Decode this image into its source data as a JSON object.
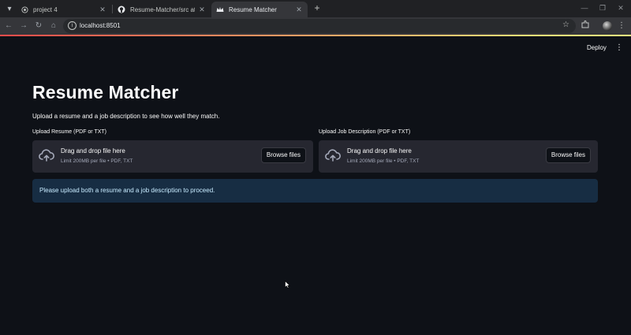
{
  "browser": {
    "tabs": [
      {
        "title": "project 4",
        "active": false
      },
      {
        "title": "Resume-Matcher/src at main · /",
        "active": false
      },
      {
        "title": "Resume Matcher",
        "active": true
      }
    ],
    "new_tab_symbol": "+",
    "url": "localhost:8501"
  },
  "app": {
    "deploy_label": "Deploy",
    "title": "Resume Matcher",
    "subtitle": "Upload a resume and a job description to see how well they match.",
    "uploaders": [
      {
        "label": "Upload Resume (PDF or TXT)",
        "drop_title": "Drag and drop file here",
        "limit_text": "Limit 200MB per file • PDF, TXT",
        "button_label": "Browse files"
      },
      {
        "label": "Upload Job Description (PDF or TXT)",
        "drop_title": "Drag and drop file here",
        "limit_text": "Limit 200MB per file • PDF, TXT",
        "button_label": "Browse files"
      }
    ],
    "info_message": "Please upload both a resume and a job description to proceed."
  },
  "colors": {
    "background": "#0e1117",
    "dropzone": "#262730",
    "info_bg": "#172d43",
    "info_text": "#c7ebff",
    "accent_gradient_start": "#ff4b4b",
    "accent_gradient_end": "#fffd80"
  },
  "icons": {
    "tab1_favicon": "globe-icon",
    "tab2_favicon": "github-icon",
    "tab3_favicon": "streamlit-crown-icon",
    "dropzone": "cloud-upload-icon"
  }
}
